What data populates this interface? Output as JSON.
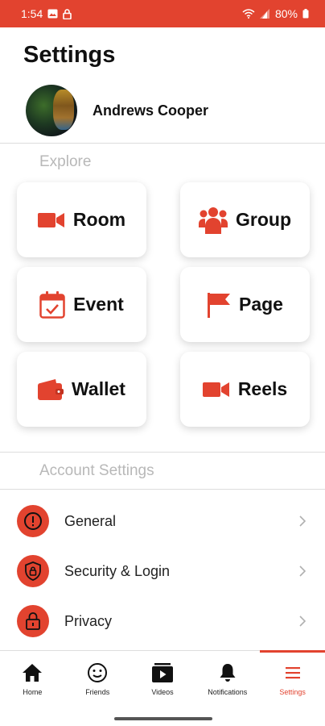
{
  "status_bar": {
    "time": "1:54",
    "battery": "80%"
  },
  "page": {
    "title": "Settings"
  },
  "profile": {
    "name": "Andrews Cooper"
  },
  "explore": {
    "label": "Explore",
    "tiles": [
      {
        "label": "Room",
        "icon": "video-camera-icon"
      },
      {
        "label": "Group",
        "icon": "group-icon"
      },
      {
        "label": "Event",
        "icon": "calendar-check-icon"
      },
      {
        "label": "Page",
        "icon": "flag-icon"
      },
      {
        "label": "Wallet",
        "icon": "wallet-icon"
      },
      {
        "label": "Reels",
        "icon": "video-camera-icon"
      }
    ]
  },
  "account_settings": {
    "label": "Account Settings",
    "items": [
      {
        "label": "General",
        "icon": "info-icon"
      },
      {
        "label": "Security & Login",
        "icon": "shield-icon"
      },
      {
        "label": "Privacy",
        "icon": "lock-icon"
      }
    ]
  },
  "bottom_nav": {
    "items": [
      {
        "label": "Home",
        "icon": "home-icon"
      },
      {
        "label": "Friends",
        "icon": "smile-icon"
      },
      {
        "label": "Videos",
        "icon": "play-icon"
      },
      {
        "label": "Notifications",
        "icon": "bell-icon"
      },
      {
        "label": "Settings",
        "icon": "menu-icon",
        "active": true
      }
    ]
  },
  "colors": {
    "accent": "#e2432f",
    "muted_label": "#b8b8b8"
  }
}
